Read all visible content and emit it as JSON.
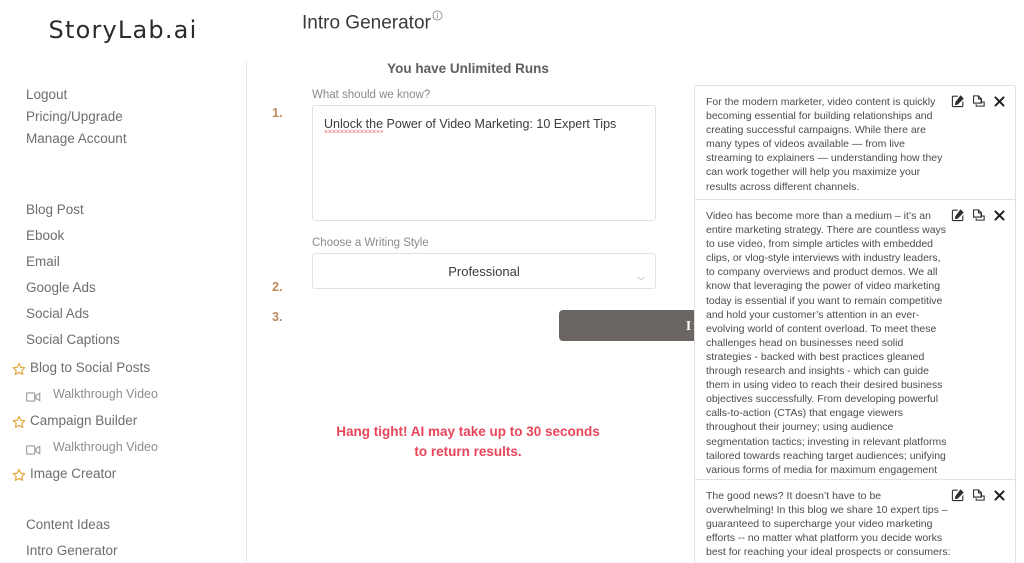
{
  "brand": {
    "name": "StoryLab.ai"
  },
  "sidebar": {
    "account": [
      {
        "label": "Logout",
        "name": "logout"
      },
      {
        "label": "Pricing/Upgrade",
        "name": "pricing-upgrade"
      },
      {
        "label": "Manage Account",
        "name": "manage-account"
      }
    ],
    "tools": [
      {
        "label": "Blog Post",
        "name": "blog-post"
      },
      {
        "label": "Ebook",
        "name": "ebook"
      },
      {
        "label": "Email",
        "name": "email"
      },
      {
        "label": "Google Ads",
        "name": "google-ads"
      },
      {
        "label": "Social Ads",
        "name": "social-ads"
      },
      {
        "label": "Social Captions",
        "name": "social-captions"
      }
    ],
    "starred": [
      {
        "label": "Blog to Social Posts",
        "icon": "star-icon",
        "name": "blog-to-social-posts"
      },
      {
        "label": "Walkthrough Video",
        "icon": "video-icon",
        "name": "walkthrough-video-blog-to-social"
      },
      {
        "label": "Campaign Builder",
        "icon": "star-icon",
        "name": "campaign-builder"
      },
      {
        "label": "Walkthrough Video",
        "icon": "video-icon",
        "name": "walkthrough-video-campaign-builder"
      },
      {
        "label": "Image Creator",
        "icon": "star-icon",
        "name": "image-creator"
      }
    ],
    "bottom": [
      {
        "label": "Content Ideas",
        "name": "content-ideas"
      },
      {
        "label": "Intro Generator",
        "name": "intro-generator"
      }
    ]
  },
  "main": {
    "page_title": "Intro Generator",
    "info_icon": "info-circle-icon",
    "runs_banner": "You have Unlimited Runs",
    "steps": {
      "one": "1.",
      "two": "2.",
      "three": "3."
    },
    "know_label": "What should we know?",
    "know_value": "Unlock the Power of Video Marketing: 10 Expert Tips",
    "know_misspelled": "Unlock the",
    "know_rest": " Power of Video Marketing: 10 Expert Tips",
    "know_placeholder": "",
    "style_label": "Choose a Writing Style",
    "style_value": "Professional",
    "style_options": [
      "Professional"
    ],
    "inspire_label": "Inspire me!",
    "hang_tight_line1": "Hang tight! AI may take up to 30 seconds",
    "hang_tight_line2": "to return results.",
    "hang_tight_color": "#e8455a",
    "accent_step_color": "#bd8a5e",
    "button_color": "#6b6663",
    "star_color": "#e0a83c"
  },
  "results": {
    "actions": {
      "edit": "edit-icon",
      "copy": "copy-icon",
      "close": "close-icon"
    },
    "cards": [
      {
        "id": "result-card-1",
        "text": "For the modern marketer, video content is quickly becoming essential for building relationships and creating successful campaigns. While there are many types of videos available — from live streaming to explainers — understanding how they can work together will help you maximize your results across different channels."
      },
      {
        "id": "result-card-2",
        "text": "Video has become more than a medium – it’s an entire marketing strategy. There are countless ways to use video, from simple articles with embedded clips, or vlog-style interviews with industry leaders, to company overviews and product demos. We all know that leveraging the power of video marketing today is essential if you want to remain competitive and hold your customer’s attention in an ever-evolving world of content overload. To meet these challenges head on businesses need solid strategies - backed with best practices gleaned through research and insights - which can guide them in using video to reach their desired business objectives successfully. From developing powerful calls-to-action (CTAs) that engage viewers throughout their journey; using audience segmentation tactics; investing in relevant platforms tailored towards reaching target audiences; unifying various forms of media for maximum engagement potential; and utilizing influencers as connectors between brands & customers: the list goes on..."
      },
      {
        "id": "result-card-3",
        "text": "The good news? It doesn’t have to be overwhelming! In this blog we share 10 expert tips – guaranteed to supercharge your video marketing efforts -- no matter what platform you decide works best for reaching your ideal prospects or consumers:"
      }
    ]
  }
}
